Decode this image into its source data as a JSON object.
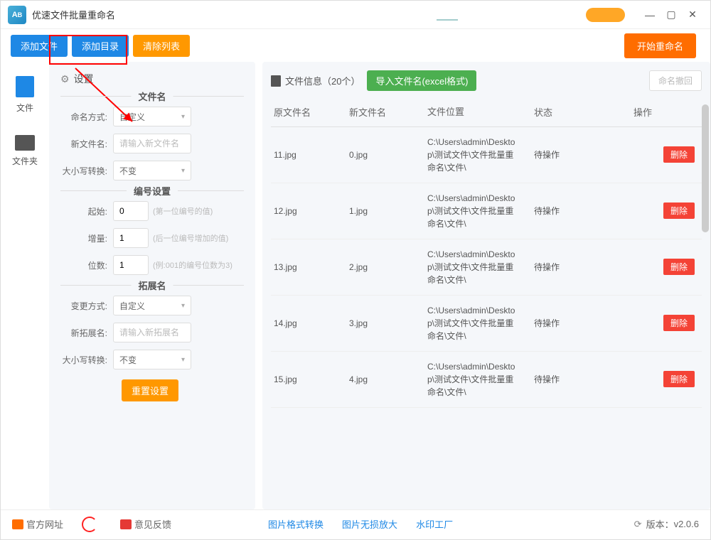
{
  "title": "优速文件批量重命名",
  "toolbar": {
    "add_file": "添加文件",
    "add_dir": "添加目录",
    "clear_list": "清除列表",
    "start_rename": "开始重命名"
  },
  "sidebar": {
    "file": "文件",
    "folder": "文件夹"
  },
  "settings": {
    "header": "设置",
    "section_filename": "文件名",
    "naming_mode_label": "命名方式:",
    "naming_mode_value": "自定义",
    "new_filename_label": "新文件名:",
    "new_filename_placeholder": "请输入新文件名",
    "case_label": "大小写转换:",
    "case_value": "不变",
    "section_number": "编号设置",
    "start_label": "起始:",
    "start_value": "0",
    "start_hint": "(第一位编号的值)",
    "step_label": "增量:",
    "step_value": "1",
    "step_hint": "(后一位编号增加的值)",
    "digits_label": "位数:",
    "digits_value": "1",
    "digits_hint": "(例:001的编号位数为3)",
    "section_ext": "拓展名",
    "ext_mode_label": "变更方式:",
    "ext_mode_value": "自定义",
    "new_ext_label": "新拓展名:",
    "new_ext_placeholder": "请输入新拓展名",
    "ext_case_label": "大小写转换:",
    "ext_case_value": "不变",
    "reset": "重置设置"
  },
  "fileinfo": {
    "header": "文件信息（20个）",
    "import": "导入文件名(excel格式)",
    "undo": "命名撤回",
    "cols": {
      "orig": "原文件名",
      "new": "新文件名",
      "path": "文件位置",
      "status": "状态",
      "action": "操作"
    },
    "rows": [
      {
        "orig": "11.jpg",
        "new": "0.jpg",
        "path": "C:\\Users\\admin\\Desktop\\测试文件\\文件批量重命名\\文件\\",
        "status": "待操作"
      },
      {
        "orig": "12.jpg",
        "new": "1.jpg",
        "path": "C:\\Users\\admin\\Desktop\\测试文件\\文件批量重命名\\文件\\",
        "status": "待操作"
      },
      {
        "orig": "13.jpg",
        "new": "2.jpg",
        "path": "C:\\Users\\admin\\Desktop\\测试文件\\文件批量重命名\\文件\\",
        "status": "待操作"
      },
      {
        "orig": "14.jpg",
        "new": "3.jpg",
        "path": "C:\\Users\\admin\\Desktop\\测试文件\\文件批量重命名\\文件\\",
        "status": "待操作"
      },
      {
        "orig": "15.jpg",
        "new": "4.jpg",
        "path": "C:\\Users\\admin\\Desktop\\测试文件\\文件批量重命名\\文件\\",
        "status": "待操作"
      }
    ],
    "delete": "删除"
  },
  "footer": {
    "official": "官方网址",
    "feedback": "意见反馈",
    "img_format": "图片格式转换",
    "img_enlarge": "图片无损放大",
    "watermark": "水印工厂",
    "version_label": "版本：",
    "version": "v2.0.6"
  }
}
